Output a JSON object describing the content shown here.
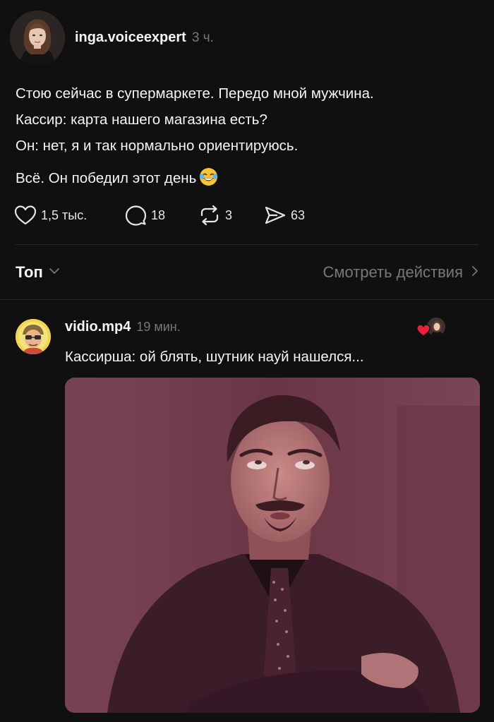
{
  "post": {
    "username": "inga.voiceexpert",
    "timestamp": "3 ч.",
    "lines": [
      "Стою сейчас в супермаркете. Передо мной мужчина.",
      "Кассир: карта нашего магазина есть?",
      "Он: нет, я и так нормально ориентируюсь."
    ],
    "last_line": "Всё. Он победил этот день",
    "emoji": "face-with-tears-of-joy",
    "likes": "1,5 тыс.",
    "comments": "18",
    "reposts": "3",
    "shares": "63"
  },
  "sort": {
    "label": "Топ",
    "view_activity": "Смотреть действия"
  },
  "reply": {
    "username": "vidio.mp4",
    "timestamp": "19 мин.",
    "text": "Кассирша: ой блять, шутник науй нашелся...",
    "liked_by_author": true,
    "image_subject": "man-rolling-eyes-meme"
  },
  "colors": {
    "background": "#101010",
    "text": "#f3f5f7",
    "muted": "#777777",
    "divider": "#2a2a2a",
    "like_heart": "#e8203a"
  }
}
